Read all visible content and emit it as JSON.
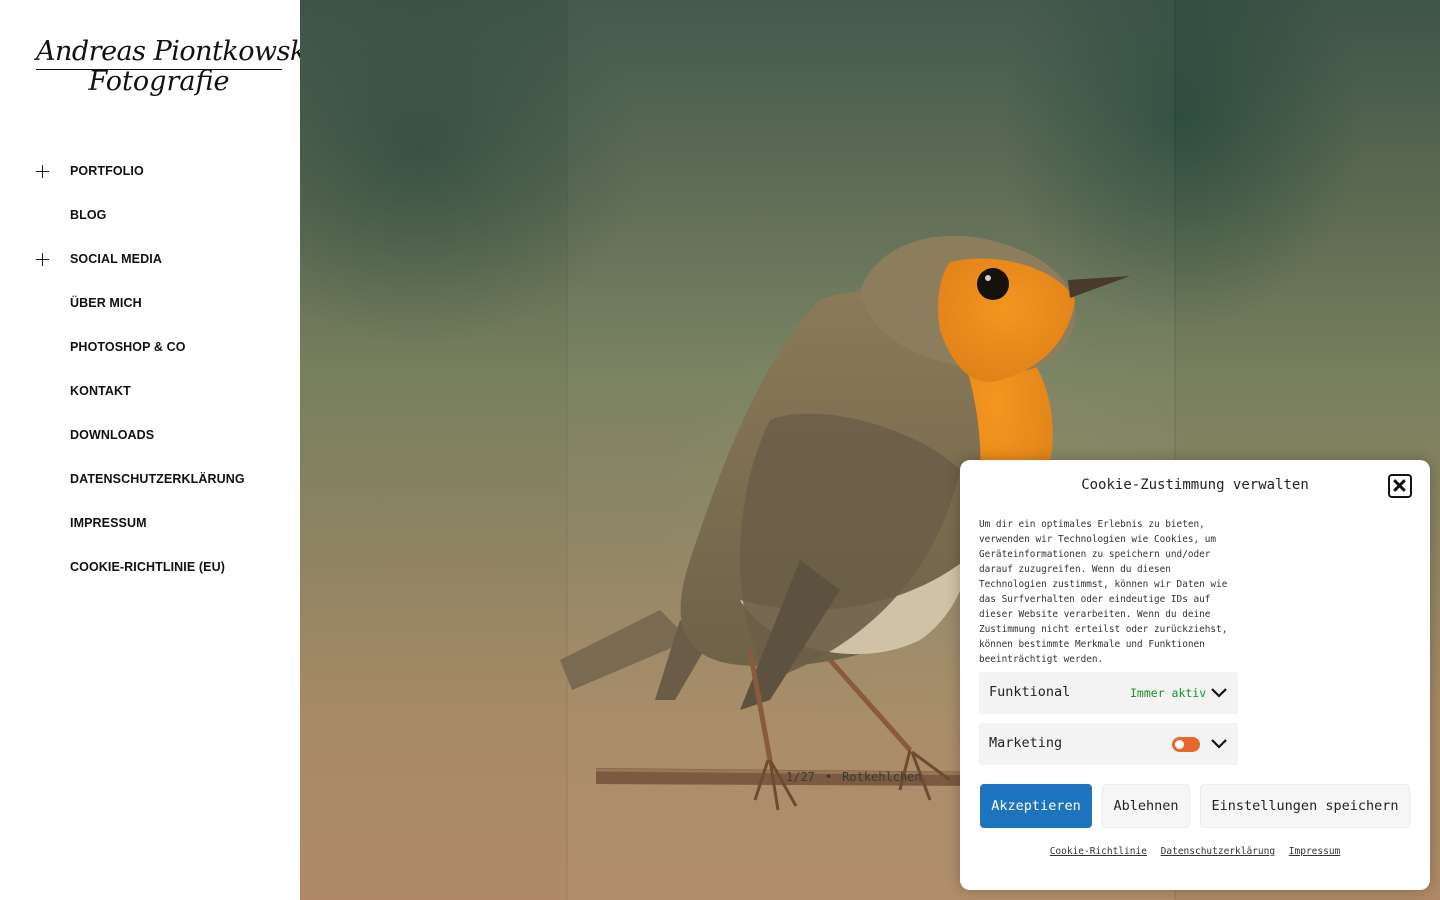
{
  "logo": {
    "line1": "Andreas Piontkowski",
    "line2": "Fotografie"
  },
  "nav": [
    {
      "label": "PORTFOLIO",
      "expandable": true
    },
    {
      "label": "BLOG",
      "expandable": false
    },
    {
      "label": "SOCIAL MEDIA",
      "expandable": true
    },
    {
      "label": "ÜBER MICH",
      "expandable": false
    },
    {
      "label": "PHOTOSHOP & CO",
      "expandable": false
    },
    {
      "label": "KONTAKT",
      "expandable": false
    },
    {
      "label": "DOWNLOADS",
      "expandable": false
    },
    {
      "label": "DATENSCHUTZERKLÄRUNG",
      "expandable": false
    },
    {
      "label": "IMPRESSUM",
      "expandable": false
    },
    {
      "label": "COOKIE-RICHTLINIE (EU)",
      "expandable": false
    }
  ],
  "hero": {
    "image_icon": "robin-bird-photo",
    "caption_left": "1/27",
    "caption_sep": "•",
    "caption_right": "Rotkehlchen"
  },
  "cookie": {
    "title": "Cookie-Zustimmung verwalten",
    "description": "Um dir ein optimales Erlebnis zu bieten, verwenden wir Technologien wie Cookies, um Geräteinformationen zu speichern und/oder darauf zuzugreifen. Wenn du diesen Technologien zustimmst, können wir Daten wie das Surfverhalten oder eindeutige IDs auf dieser Website verarbeiten. Wenn du deine Zustimmung nicht erteilst oder zurückziehst, können bestimmte Merkmale und Funktionen beeinträchtigt werden.",
    "categories": [
      {
        "name": "Funktional",
        "status": "Immer aktiv"
      },
      {
        "name": "Marketing",
        "toggle": "off"
      }
    ],
    "buttons": {
      "accept": "Akzeptieren",
      "deny": "Ablehnen",
      "save": "Einstellungen speichern"
    },
    "links": [
      "Cookie-Richtlinie",
      "Datenschutzerklärung",
      "Impressum"
    ],
    "colors": {
      "accept": "#1e73be",
      "always_active": "#1f8b2f",
      "toggle": "#e8672d"
    }
  }
}
